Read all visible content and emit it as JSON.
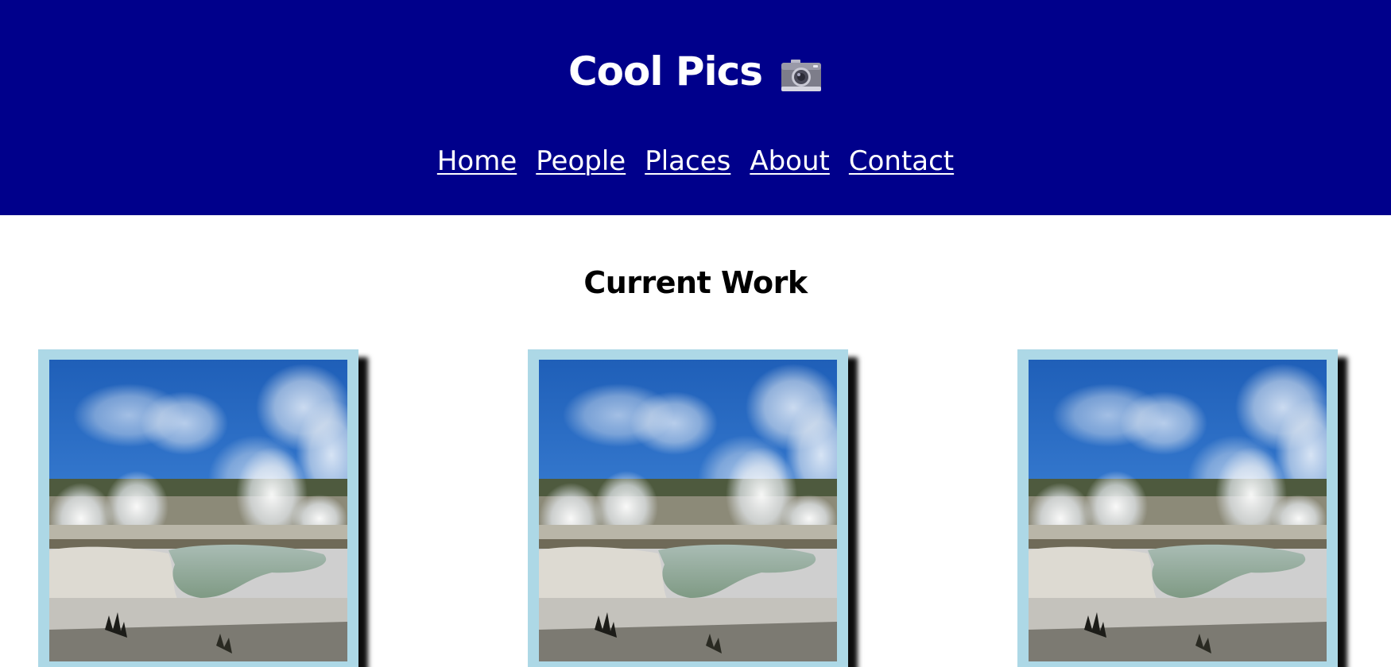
{
  "header": {
    "title": "Cool Pics",
    "title_icon": "camera-icon",
    "background_color": "#00008b"
  },
  "nav": {
    "items": [
      {
        "label": "Home"
      },
      {
        "label": "People"
      },
      {
        "label": "Places"
      },
      {
        "label": "About"
      },
      {
        "label": "Contact"
      }
    ]
  },
  "main": {
    "section_title": "Current Work",
    "frame_color": "#add8e6",
    "photos": [
      {
        "subject": "geyser-landscape"
      },
      {
        "subject": "geyser-landscape"
      },
      {
        "subject": "geyser-landscape"
      }
    ]
  }
}
